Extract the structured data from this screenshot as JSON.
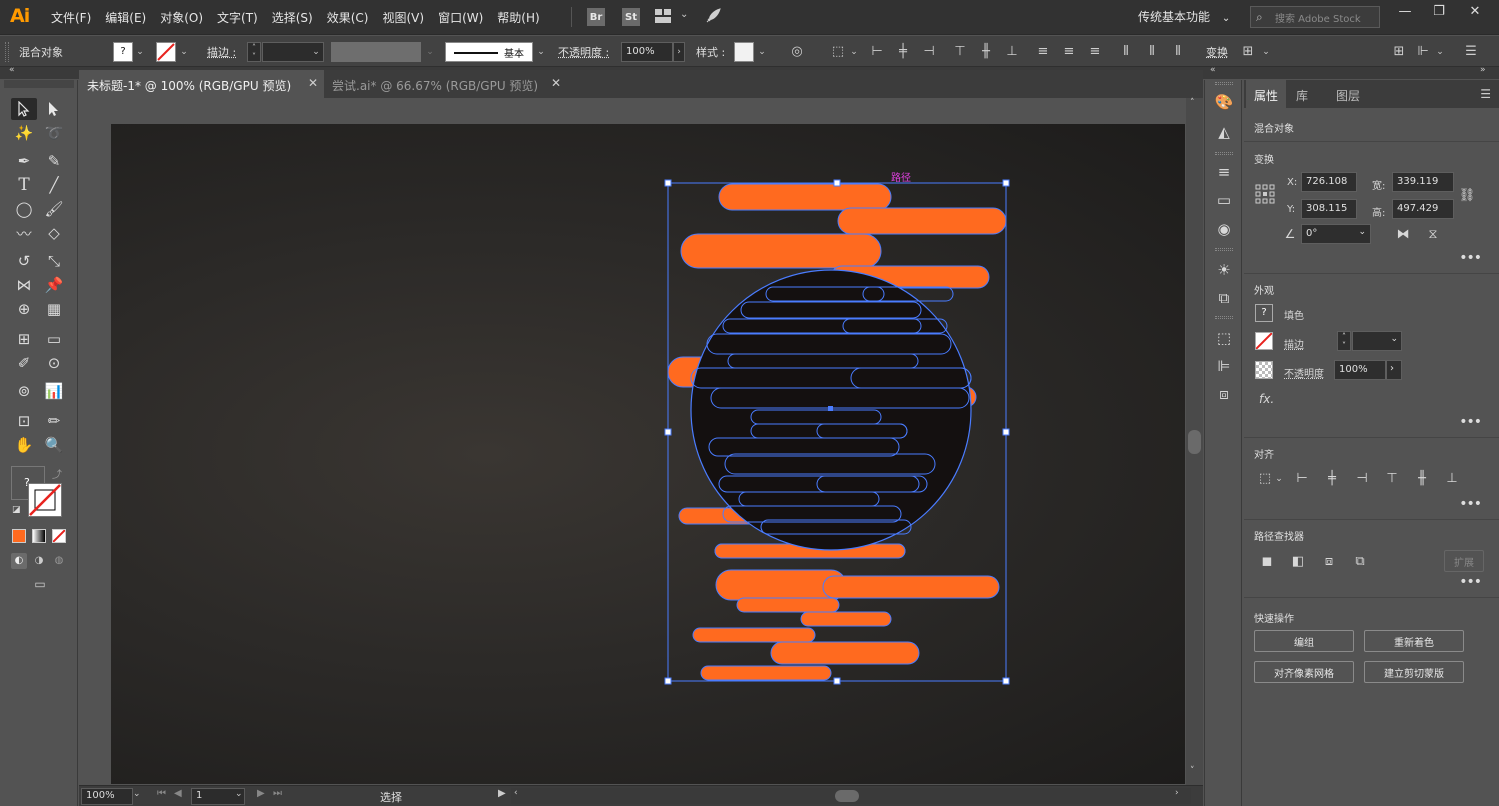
{
  "app": {
    "logo": "Ai",
    "menus": [
      "文件(F)",
      "编辑(E)",
      "对象(O)",
      "文字(T)",
      "选择(S)",
      "效果(C)",
      "视图(V)",
      "窗口(W)",
      "帮助(H)"
    ],
    "bridge_label": "Br",
    "stock_label": "St",
    "workspace": "传统基本功能",
    "search_placeholder": "搜索 Adobe Stock",
    "window_controls": [
      "—",
      "❐",
      "✕"
    ]
  },
  "controlbar": {
    "selection_type": "混合对象",
    "fill_swatch": "?",
    "stroke_label": "描边 :",
    "stroke_profile": "基本",
    "opacity_label": "不透明度 :",
    "opacity_value": "100%",
    "style_label": "样式 :",
    "transform_label": "变换"
  },
  "tabs": [
    {
      "label": "未标题-1* @ 100% (RGB/GPU 预览)",
      "close": "✕"
    },
    {
      "label": "尝试.ai* @ 66.67% (RGB/GPU 预览)",
      "close": "✕"
    }
  ],
  "canvas": {
    "hover_label": "路径",
    "colors": {
      "shape_fill": "#ff6a1f",
      "selection": "#4a7cff",
      "circle_fill": "#141010",
      "hover_label": "#e040e0"
    }
  },
  "statusbar": {
    "zoom": "100%",
    "artboard": "1",
    "tool_name": "选择"
  },
  "properties": {
    "tabs": [
      "属性",
      "库",
      "图层"
    ],
    "selection_type": "混合对象",
    "transform": {
      "title": "变换",
      "x_label": "X:",
      "x": "726.108",
      "y_label": "Y:",
      "y": "308.115",
      "w_label": "宽:",
      "w": "339.119",
      "h_label": "高:",
      "h": "497.429",
      "angle": "0°"
    },
    "appearance": {
      "title": "外观",
      "fill_label": "填色",
      "fill_swatch": "?",
      "stroke_label": "描边",
      "opacity_label": "不透明度",
      "opacity_value": "100%",
      "fx": "fx."
    },
    "align_title": "对齐",
    "pathfinder": {
      "title": "路径查找器",
      "expand": "扩展"
    },
    "quick_actions": {
      "title": "快速操作",
      "buttons": [
        "编组",
        "重新着色",
        "对齐像素网格",
        "建立剪切蒙版"
      ]
    },
    "more": "•••"
  },
  "toolbox": {
    "fill_swatch": "?"
  }
}
